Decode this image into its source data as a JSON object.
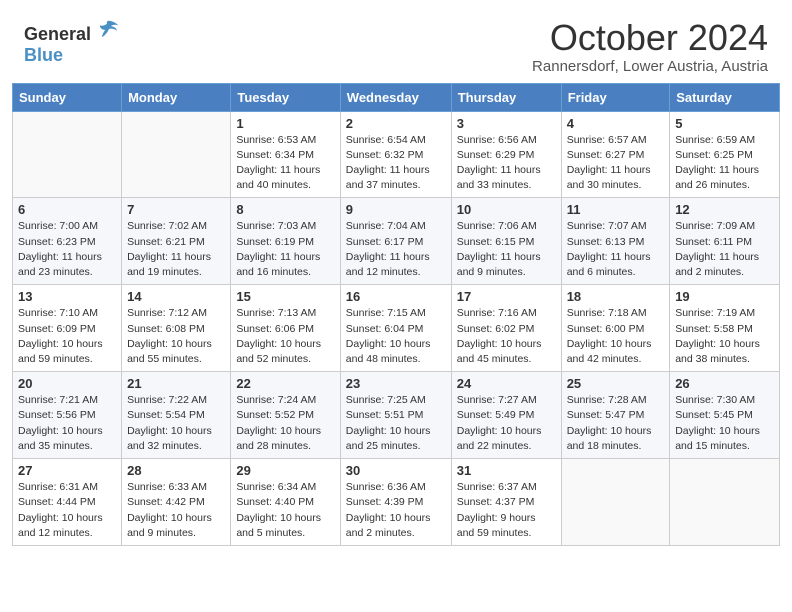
{
  "header": {
    "logo_general": "General",
    "logo_blue": "Blue",
    "month": "October 2024",
    "location": "Rannersdorf, Lower Austria, Austria"
  },
  "weekdays": [
    "Sunday",
    "Monday",
    "Tuesday",
    "Wednesday",
    "Thursday",
    "Friday",
    "Saturday"
  ],
  "weeks": [
    [
      {
        "day": "",
        "info": ""
      },
      {
        "day": "",
        "info": ""
      },
      {
        "day": "1",
        "info": "Sunrise: 6:53 AM\nSunset: 6:34 PM\nDaylight: 11 hours and 40 minutes."
      },
      {
        "day": "2",
        "info": "Sunrise: 6:54 AM\nSunset: 6:32 PM\nDaylight: 11 hours and 37 minutes."
      },
      {
        "day": "3",
        "info": "Sunrise: 6:56 AM\nSunset: 6:29 PM\nDaylight: 11 hours and 33 minutes."
      },
      {
        "day": "4",
        "info": "Sunrise: 6:57 AM\nSunset: 6:27 PM\nDaylight: 11 hours and 30 minutes."
      },
      {
        "day": "5",
        "info": "Sunrise: 6:59 AM\nSunset: 6:25 PM\nDaylight: 11 hours and 26 minutes."
      }
    ],
    [
      {
        "day": "6",
        "info": "Sunrise: 7:00 AM\nSunset: 6:23 PM\nDaylight: 11 hours and 23 minutes."
      },
      {
        "day": "7",
        "info": "Sunrise: 7:02 AM\nSunset: 6:21 PM\nDaylight: 11 hours and 19 minutes."
      },
      {
        "day": "8",
        "info": "Sunrise: 7:03 AM\nSunset: 6:19 PM\nDaylight: 11 hours and 16 minutes."
      },
      {
        "day": "9",
        "info": "Sunrise: 7:04 AM\nSunset: 6:17 PM\nDaylight: 11 hours and 12 minutes."
      },
      {
        "day": "10",
        "info": "Sunrise: 7:06 AM\nSunset: 6:15 PM\nDaylight: 11 hours and 9 minutes."
      },
      {
        "day": "11",
        "info": "Sunrise: 7:07 AM\nSunset: 6:13 PM\nDaylight: 11 hours and 6 minutes."
      },
      {
        "day": "12",
        "info": "Sunrise: 7:09 AM\nSunset: 6:11 PM\nDaylight: 11 hours and 2 minutes."
      }
    ],
    [
      {
        "day": "13",
        "info": "Sunrise: 7:10 AM\nSunset: 6:09 PM\nDaylight: 10 hours and 59 minutes."
      },
      {
        "day": "14",
        "info": "Sunrise: 7:12 AM\nSunset: 6:08 PM\nDaylight: 10 hours and 55 minutes."
      },
      {
        "day": "15",
        "info": "Sunrise: 7:13 AM\nSunset: 6:06 PM\nDaylight: 10 hours and 52 minutes."
      },
      {
        "day": "16",
        "info": "Sunrise: 7:15 AM\nSunset: 6:04 PM\nDaylight: 10 hours and 48 minutes."
      },
      {
        "day": "17",
        "info": "Sunrise: 7:16 AM\nSunset: 6:02 PM\nDaylight: 10 hours and 45 minutes."
      },
      {
        "day": "18",
        "info": "Sunrise: 7:18 AM\nSunset: 6:00 PM\nDaylight: 10 hours and 42 minutes."
      },
      {
        "day": "19",
        "info": "Sunrise: 7:19 AM\nSunset: 5:58 PM\nDaylight: 10 hours and 38 minutes."
      }
    ],
    [
      {
        "day": "20",
        "info": "Sunrise: 7:21 AM\nSunset: 5:56 PM\nDaylight: 10 hours and 35 minutes."
      },
      {
        "day": "21",
        "info": "Sunrise: 7:22 AM\nSunset: 5:54 PM\nDaylight: 10 hours and 32 minutes."
      },
      {
        "day": "22",
        "info": "Sunrise: 7:24 AM\nSunset: 5:52 PM\nDaylight: 10 hours and 28 minutes."
      },
      {
        "day": "23",
        "info": "Sunrise: 7:25 AM\nSunset: 5:51 PM\nDaylight: 10 hours and 25 minutes."
      },
      {
        "day": "24",
        "info": "Sunrise: 7:27 AM\nSunset: 5:49 PM\nDaylight: 10 hours and 22 minutes."
      },
      {
        "day": "25",
        "info": "Sunrise: 7:28 AM\nSunset: 5:47 PM\nDaylight: 10 hours and 18 minutes."
      },
      {
        "day": "26",
        "info": "Sunrise: 7:30 AM\nSunset: 5:45 PM\nDaylight: 10 hours and 15 minutes."
      }
    ],
    [
      {
        "day": "27",
        "info": "Sunrise: 6:31 AM\nSunset: 4:44 PM\nDaylight: 10 hours and 12 minutes."
      },
      {
        "day": "28",
        "info": "Sunrise: 6:33 AM\nSunset: 4:42 PM\nDaylight: 10 hours and 9 minutes."
      },
      {
        "day": "29",
        "info": "Sunrise: 6:34 AM\nSunset: 4:40 PM\nDaylight: 10 hours and 5 minutes."
      },
      {
        "day": "30",
        "info": "Sunrise: 6:36 AM\nSunset: 4:39 PM\nDaylight: 10 hours and 2 minutes."
      },
      {
        "day": "31",
        "info": "Sunrise: 6:37 AM\nSunset: 4:37 PM\nDaylight: 9 hours and 59 minutes."
      },
      {
        "day": "",
        "info": ""
      },
      {
        "day": "",
        "info": ""
      }
    ]
  ]
}
